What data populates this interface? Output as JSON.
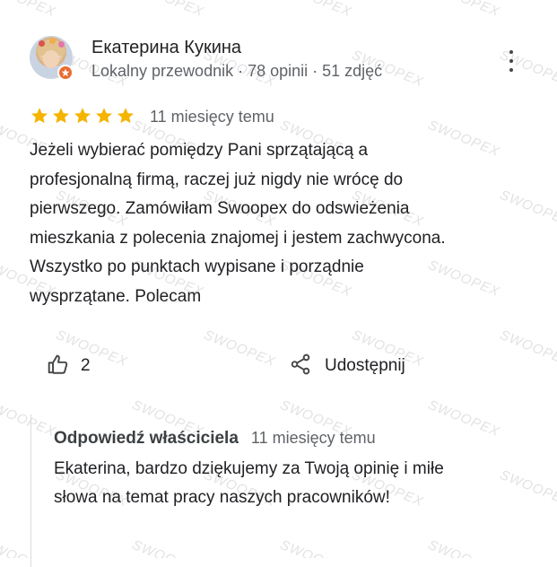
{
  "review": {
    "author_name": "Екатерина Кукина",
    "author_meta": "Lokalny przewodnik · 78 opinii · 51 zdjęć",
    "rating": 5,
    "date": "11 miesięcy temu",
    "text_lines": [
      "Jeżeli wybierać pomiędzy Pani sprzątającą a",
      "profesjonalną firmą, raczej już nigdy nie wrócę do",
      "pierwszego. Zamówiłam Swoopex do odswieżenia",
      "mieszkania z polecenia znajomej i jestem zachwycona.",
      "Wszystko po punktach wypisane i porządnie",
      "wysprzątane. Polecam"
    ],
    "like_count": "2",
    "share_label": "Udostępnij"
  },
  "owner_reply": {
    "label": "Odpowiedź właściciela",
    "date": "11 miesięcy temu",
    "text_lines": [
      "Ekaterina, bardzo dziękujemy za Twoją opinię i miłe",
      "słowa na temat pracy naszych pracowników!"
    ]
  },
  "watermark": "SWOOPEX",
  "colors": {
    "star": "#f4b400",
    "secondary_text": "#5f6368",
    "badge": "#ea6b2e",
    "divider": "#dadce0"
  },
  "icons": {
    "more": "more-vert-icon",
    "like": "thumb-up-icon",
    "share": "share-icon",
    "star": "star-icon",
    "badge": "local-guide-icon"
  }
}
